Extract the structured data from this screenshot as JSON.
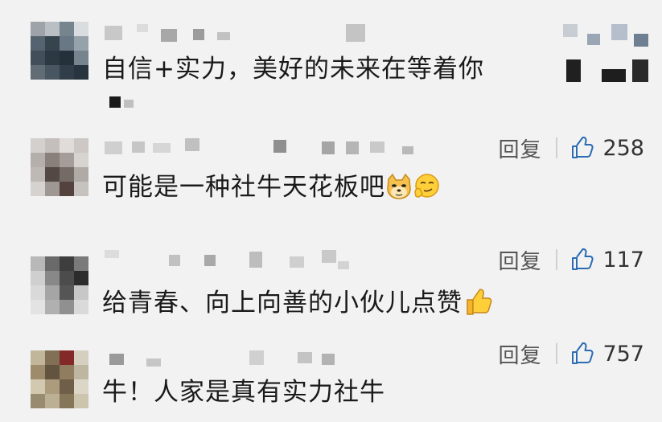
{
  "comments": [
    {
      "text": "自信+实力，美好的未来在等着你",
      "reply_label": "",
      "like_count": ""
    },
    {
      "text": "可能是一种社牛天花板吧",
      "reply_label": "回复",
      "like_count": "258"
    },
    {
      "text": "给青春、向上向善的小伙儿点赞",
      "reply_label": "回复",
      "like_count": "117"
    },
    {
      "text": "牛！人家是真有实力社牛",
      "reply_label": "回复",
      "like_count": "757"
    }
  ],
  "icons": {
    "like": "thumbs-up-outline-icon",
    "emoji_doge": "doge-face-icon",
    "emoji_smirk": "smirk-face-icon",
    "emoji_thumbsup": "thumbs-up-emoji-icon"
  },
  "colors": {
    "background": "#f2f2f2",
    "text": "#1a1a1a",
    "reply": "#555555",
    "divider": "#d0d0d0",
    "like_outline": "#2b6bb3"
  }
}
